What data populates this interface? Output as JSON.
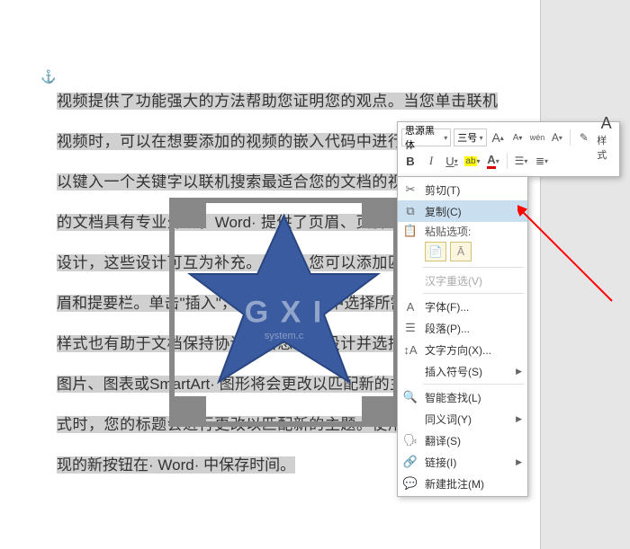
{
  "anchor_glyph": "⚓",
  "document_text": "视频提供了功能强大的方法帮助您证明您的观点。当您单击联机视频时，可以在想要添加的视频的嵌入代码中进行粘贴。您也可以键入一个关键字以联机搜索最适合您的文档的视频。为了使您的文档具有专业外观，Word· 提供了页眉、页脚、封面和文本框设计，这些设计可互为补充。例如，您可以添加匹配的封面、页眉和提要栏。单击\"插入\"，然后从不同库中选择所需元素。主题和样式也有助于文档保持协调。当您单击设计并选择新的主题时，图片、图表或SmartArt· 图形将会更改以匹配新的主题。当应用样式时，您的标题会进行更改以匹配新的主题。使用在需要位置出现的新按钮在· Word· 中保存时间。",
  "watermark": {
    "main": "G X I",
    "sub": "system.c"
  },
  "mini_toolbar": {
    "font_name": "思源黑体",
    "font_size": "三号",
    "grow": "A",
    "shrink": "A",
    "ruby": "wén",
    "a_case": "A",
    "format_painter": "✎",
    "bold": "B",
    "italic": "I",
    "underline": "U",
    "highlight": "ab",
    "font_color": "A",
    "styles_label": "样式"
  },
  "context_menu": {
    "cut": "剪切(T)",
    "copy": "复制(C)",
    "paste_header": "粘贴选项:",
    "hanzi": "汉字重选(V)",
    "font": "字体(F)...",
    "paragraph": "段落(P)...",
    "text_dir": "文字方向(X)...",
    "insert_symbol": "插入符号(S)",
    "smart_lookup": "智能查找(L)",
    "thesaurus": "同义词(Y)",
    "translate": "翻译(S)",
    "link": "链接(I)",
    "new_comment": "新建批注(M)"
  }
}
